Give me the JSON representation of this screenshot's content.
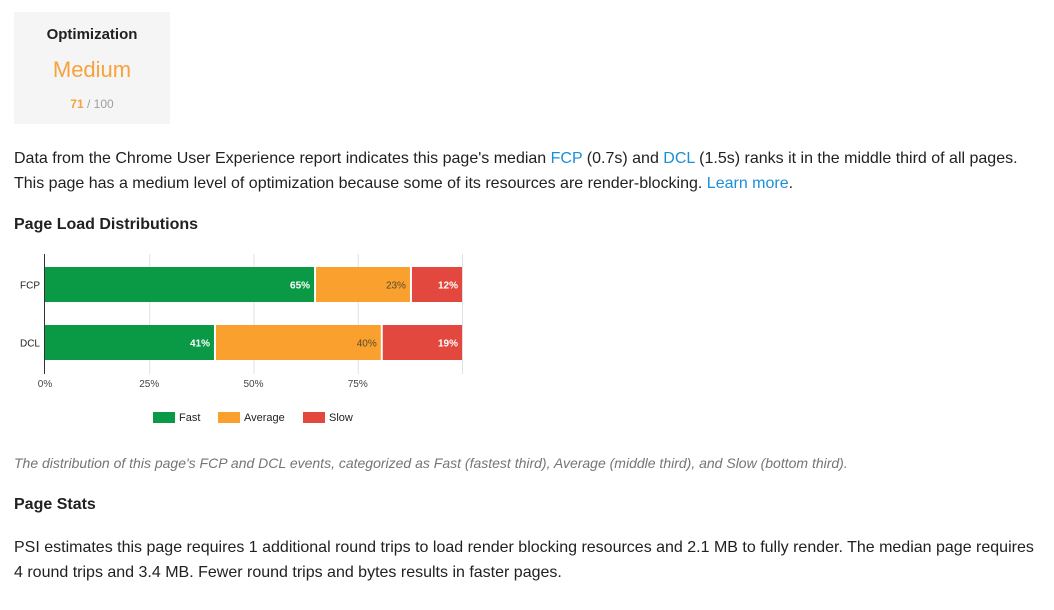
{
  "score_card": {
    "title": "Optimization",
    "level": "Medium",
    "score": "71",
    "max": "/ 100"
  },
  "intro": {
    "text_1": "Data from the Chrome User Experience report indicates this page's median ",
    "fcp_link": "FCP",
    "text_2": " (0.7s) and ",
    "dcl_link": "DCL",
    "text_3": " (1.5s) ranks it in the middle third of all pages. This page has a medium level of optimization because some of its resources are render-blocking. ",
    "learn_more": "Learn more",
    "text_4": "."
  },
  "distributions_heading": "Page Load Distributions",
  "chart_data": {
    "type": "bar",
    "orientation": "horizontal",
    "stacked": true,
    "categories": [
      "FCP",
      "DCL"
    ],
    "series": [
      {
        "name": "Fast",
        "color": "#0a9a46",
        "values": [
          65,
          41
        ],
        "labels": [
          "65%",
          "41%"
        ]
      },
      {
        "name": "Average",
        "color": "#f9a02f",
        "values": [
          23,
          40
        ],
        "labels": [
          "23%",
          "40%"
        ]
      },
      {
        "name": "Slow",
        "color": "#e2483d",
        "values": [
          12,
          19
        ],
        "labels": [
          "12%",
          "19%"
        ]
      }
    ],
    "x_ticks": [
      "0%",
      "25%",
      "50%",
      "75%"
    ],
    "xlim": [
      0,
      100
    ],
    "grid": true,
    "legend_position": "bottom"
  },
  "caption": "The distribution of this page's FCP and DCL events, categorized as Fast (fastest third), Average (middle third), and Slow (bottom third).",
  "stats_heading": "Page Stats",
  "stats_text": "PSI estimates this page requires 1 additional round trips to load render blocking resources and 2.1 MB to fully render. The median page requires 4 round trips and 3.4 MB. Fewer round trips and bytes results in faster pages."
}
